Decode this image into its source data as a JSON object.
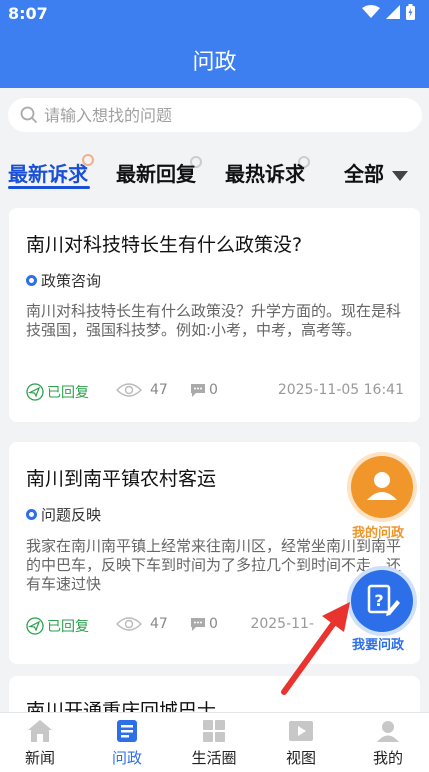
{
  "status_bar": {
    "time": "8:07"
  },
  "header": {
    "title": "问政"
  },
  "search": {
    "placeholder": "请输入想找的问题"
  },
  "tabs": [
    {
      "label": "最新诉求",
      "active": true
    },
    {
      "label": "最新回复",
      "active": false
    },
    {
      "label": "最热诉求",
      "active": false
    },
    {
      "label": "全部",
      "active": false
    }
  ],
  "cards": [
    {
      "title": "南川对科技特长生有什么政策没?",
      "category": "政策咨询",
      "body": "南川对科技特长生有什么政策没？升学方面的。现在是科技强国，强国科技梦。例如:小考，中考，高考等。",
      "status": "已回复",
      "views": "47",
      "comments": "0",
      "date": "2025-11-05 16:41"
    },
    {
      "title": "南川到南平镇农村客运",
      "category": "问题反映",
      "body": "我家在南川南平镇上经常来往南川区，经常坐南川到南平的中巴车，反映下车到时间为了多拉几个到时间不走，还有车速过快",
      "status": "已回复",
      "views": "47",
      "comments": "0",
      "date": "2025-11-"
    },
    {
      "title": "南川开通重庆回城巴士"
    }
  ],
  "floating": {
    "my_questions": "我的问政",
    "ask_question": "我要问政"
  },
  "bottom_nav": [
    {
      "label": "新闻",
      "icon": "home-icon",
      "active": false
    },
    {
      "label": "问政",
      "icon": "document-icon",
      "active": true
    },
    {
      "label": "生活圈",
      "icon": "grid-icon",
      "active": false
    },
    {
      "label": "视图",
      "icon": "video-icon",
      "active": false
    },
    {
      "label": "我的",
      "icon": "user-icon",
      "active": false
    }
  ],
  "colors": {
    "primary": "#3d7ff0",
    "active_tab": "#1a4fd8",
    "replied_green": "#2aa14c",
    "orange": "#f0962b",
    "annotation_arrow": "#e8332f"
  }
}
